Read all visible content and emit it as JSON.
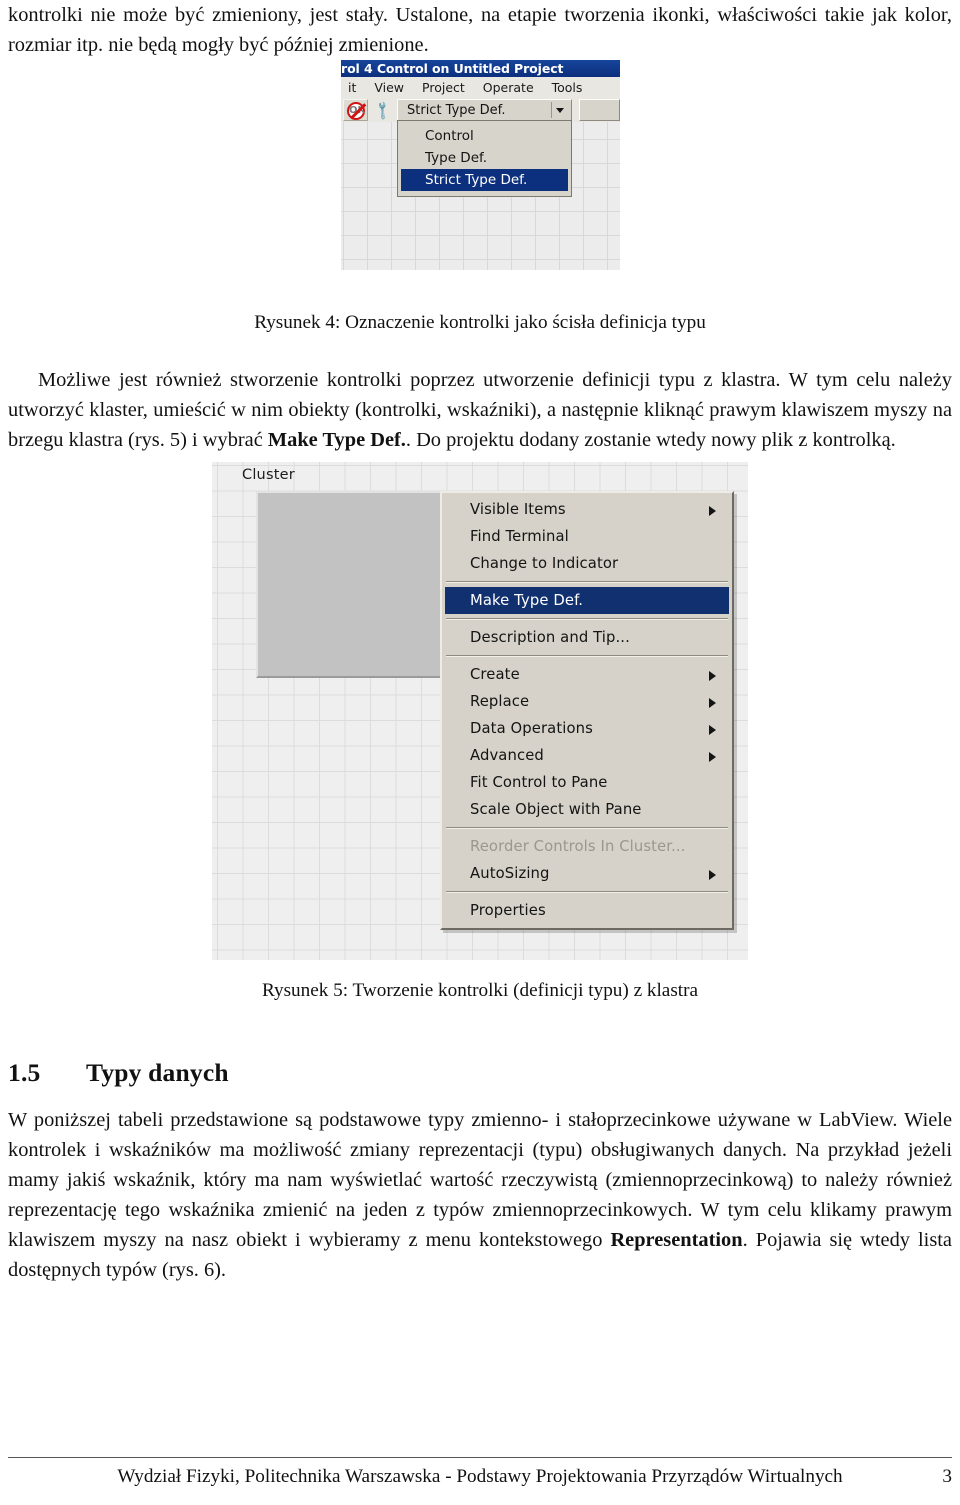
{
  "document": {
    "paragraphs": {
      "intro": "kontrolki nie może być zmieniony, jest stały. Ustalone, na etapie tworzenia ikonki, właściwości takie jak kolor, rozmiar itp. nie będą mogły być później zmienione.",
      "middle_pre": "Możliwe jest również stworzenie kontrolki poprzez utworzenie definicji typu z klastra. W tym celu należy utworzyć klaster, umieścić w nim obiekty (kontrolki, wskaźniki), a następnie kliknąć prawym klawiszem myszy na brzegu klastra (rys. 5) i wybrać ",
      "middle_bold": "Make Type Def.",
      "middle_post": ". Do projektu dodany zostanie wtedy nowy plik z kontrolką.",
      "last_pre": "W poniższej tabeli przedstawione są podstawowe typy zmienno- i stałoprzecinkowe używane w LabView. Wiele kontrolek i wskaźników ma możliwość zmiany reprezentacji (typu) obsługiwanych danych. Na przykład jeżeli mamy jakiś wskaźnik, który ma nam wyświetlać wartość rzeczywistą (zmiennoprzecinkową) to należy również reprezentację tego wskaźnika zmienić na jeden z typów zmiennoprzecinkowych. W tym celu klikamy prawym klawiszem myszy na nasz obiekt i wybieramy z menu kontekstowego ",
      "last_bold": "Representation",
      "last_post": ". Pojawia się wtedy lista dostępnych typów (rys. 6)."
    },
    "captions": {
      "figure4": "Rysunek 4: Oznaczenie kontrolki jako ścisła definicja typu",
      "figure5": "Rysunek 5: Tworzenie kontrolki (definicji typu) z klastra"
    },
    "heading": {
      "number": "1.5",
      "title": "Typy danych"
    },
    "footer": {
      "text": "Wydział Fizyki, Politechnika Warszawska - Podstawy Projektowania Przyrządów Wirtualnych",
      "page_number": "3"
    }
  },
  "figure4": {
    "window": {
      "title": "rol 4 Control on Untitled Project",
      "menu_items": [
        "it",
        "View",
        "Project",
        "Operate",
        "Tools"
      ],
      "toolbar": {
        "run_broken_icon": "ok-broken-icon",
        "run_broken_label": "OK",
        "wrench_icon": "wrench-icon"
      },
      "combo": {
        "value": "Strict Type Def.",
        "arrow_icon": "chevron-down-icon",
        "options": [
          "Control",
          "Type Def.",
          "Strict Type Def."
        ],
        "selected": "Strict Type Def."
      }
    }
  },
  "figure5": {
    "cluster_label": "Cluster",
    "context_menu": {
      "items": [
        {
          "label": "Visible Items",
          "submenu": true,
          "selected": false,
          "disabled": false,
          "separator_after": false
        },
        {
          "label": "Find Terminal",
          "submenu": false,
          "selected": false,
          "disabled": false,
          "separator_after": false
        },
        {
          "label": "Change to Indicator",
          "submenu": false,
          "selected": false,
          "disabled": false,
          "separator_after": true
        },
        {
          "label": "Make Type Def.",
          "submenu": false,
          "selected": true,
          "disabled": false,
          "separator_after": true
        },
        {
          "label": "Description and Tip...",
          "submenu": false,
          "selected": false,
          "disabled": false,
          "separator_after": true
        },
        {
          "label": "Create",
          "submenu": true,
          "selected": false,
          "disabled": false,
          "separator_after": false
        },
        {
          "label": "Replace",
          "submenu": true,
          "selected": false,
          "disabled": false,
          "separator_after": false
        },
        {
          "label": "Data Operations",
          "submenu": true,
          "selected": false,
          "disabled": false,
          "separator_after": false
        },
        {
          "label": "Advanced",
          "submenu": true,
          "selected": false,
          "disabled": false,
          "separator_after": false
        },
        {
          "label": "Fit Control to Pane",
          "submenu": false,
          "selected": false,
          "disabled": false,
          "separator_after": false
        },
        {
          "label": "Scale Object with Pane",
          "submenu": false,
          "selected": false,
          "disabled": false,
          "separator_after": true
        },
        {
          "label": "Reorder Controls In Cluster...",
          "submenu": false,
          "selected": false,
          "disabled": true,
          "separator_after": false
        },
        {
          "label": "AutoSizing",
          "submenu": true,
          "selected": false,
          "disabled": false,
          "separator_after": true
        },
        {
          "label": "Properties",
          "submenu": false,
          "selected": false,
          "disabled": false,
          "separator_after": false
        }
      ]
    }
  },
  "colors": {
    "titlebar": "#0c2f7e",
    "menu_highlight": "#11306f",
    "menu_face": "#d6d2c9",
    "broken_run_red": "#d01414"
  }
}
